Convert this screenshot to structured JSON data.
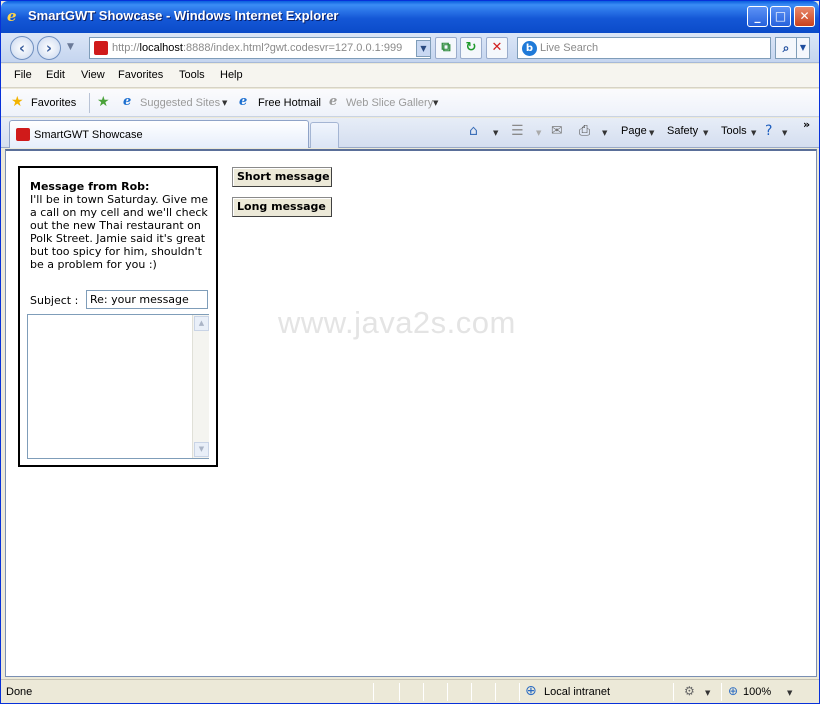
{
  "window": {
    "title": "SmartGWT Showcase - Windows Internet Explorer",
    "minimize_glyph": "_",
    "maximize_glyph": "□",
    "close_glyph": "✕"
  },
  "address_bar": {
    "url_scheme": "http://",
    "url_host": "localhost",
    "url_rest": ":8888/index.html?gwt.codesvr=127.0.0.1:999",
    "search_placeholder": "Live Search"
  },
  "menu": {
    "items": [
      "File",
      "Edit",
      "View",
      "Favorites",
      "Tools",
      "Help"
    ]
  },
  "favorites_bar": {
    "favorites_label": "Favorites",
    "links": [
      "Suggested Sites",
      "Free Hotmail",
      "Web Slice Gallery"
    ]
  },
  "tabs": {
    "active_label": "SmartGWT Showcase"
  },
  "command_bar": {
    "page_label": "Page",
    "safety_label": "Safety",
    "tools_label": "Tools"
  },
  "message": {
    "title": "Message from Rob:",
    "body": "I'll be in town Saturday. Give me a call on my cell and we'll check out the new Thai restaurant on Polk Street. Jamie said it's great but too spicy for him, shouldn't be a problem for you :)",
    "subject_label": "Subject :",
    "subject_value": "Re: your message",
    "reply_value": ""
  },
  "buttons": {
    "short_message": "Short message",
    "long_message": "Long message"
  },
  "watermark": "www.java2s.com",
  "status_bar": {
    "status": "Done",
    "zone": "Local intranet",
    "zoom": "100%"
  }
}
